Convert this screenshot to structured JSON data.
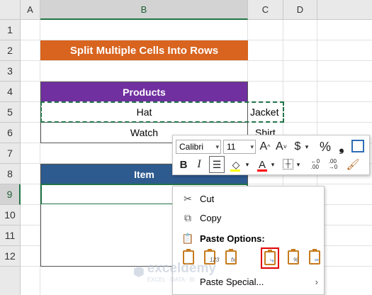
{
  "columns": [
    "A",
    "B",
    "C",
    "D"
  ],
  "rows": [
    "1",
    "2",
    "3",
    "4",
    "5",
    "6",
    "7",
    "8",
    "9",
    "10",
    "11",
    "12"
  ],
  "title": "Split Multiple Cells Into Rows",
  "table1": {
    "header": "Products",
    "rows": [
      "Hat",
      "Watch"
    ]
  },
  "col_c": [
    "Jacket",
    "Shirt"
  ],
  "table2": {
    "header": "Item"
  },
  "mini_toolbar": {
    "font_name": "Calibri",
    "font_size": "11",
    "increase_font": "A^",
    "decrease_font": "A˅",
    "currency": "$",
    "percent": "%",
    "comma": "❟",
    "bold": "B",
    "italic": "I",
    "font_color_letter": "A"
  },
  "context_menu": {
    "cut": "Cut",
    "copy": "Copy",
    "paste_options": "Paste Options:",
    "paste_special": "Paste Special...",
    "paste_overlays": [
      "",
      "123",
      "fx",
      "",
      "%",
      ""
    ]
  },
  "watermark": {
    "name": "exceldemy",
    "tagline": "EXCEL · DATA · BI"
  },
  "colors": {
    "title_bg": "#d8641f",
    "products_bg": "#7030a0",
    "item_bg": "#2e5b8f",
    "excel_green": "#217346",
    "highlight": "#e00000"
  }
}
